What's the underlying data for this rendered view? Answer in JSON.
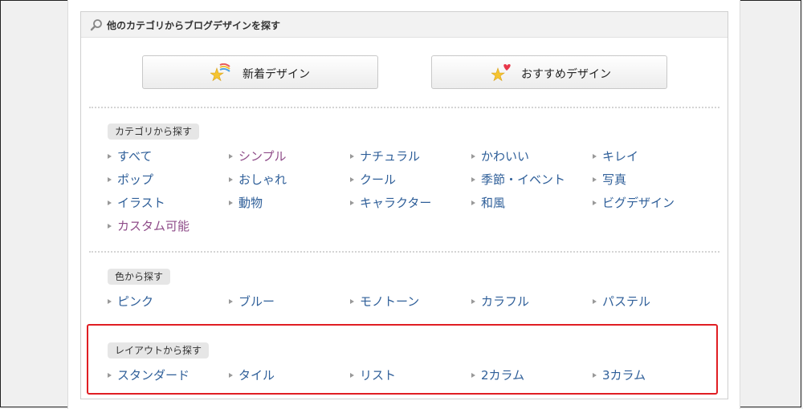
{
  "panel": {
    "title": "他のカテゴリからブログデザインを探す",
    "search_icon": "search-icon"
  },
  "buttons": [
    {
      "label": "新着デザイン",
      "icon": "star-rainbow-icon"
    },
    {
      "label": "おすすめデザイン",
      "icon": "star-heart-icon"
    }
  ],
  "sections": {
    "category": {
      "tag": "カテゴリから探す",
      "items": [
        {
          "label": "すべて"
        },
        {
          "label": "シンプル",
          "visited": true
        },
        {
          "label": "ナチュラル"
        },
        {
          "label": "かわいい"
        },
        {
          "label": "キレイ"
        },
        {
          "label": "ポップ"
        },
        {
          "label": "おしゃれ"
        },
        {
          "label": "クール"
        },
        {
          "label": "季節・イベント"
        },
        {
          "label": "写真"
        },
        {
          "label": "イラスト"
        },
        {
          "label": "動物"
        },
        {
          "label": "キャラクター"
        },
        {
          "label": "和風"
        },
        {
          "label": "ビグデザイン"
        },
        {
          "label": "カスタム可能",
          "visited": true
        }
      ]
    },
    "color": {
      "tag": "色から探す",
      "items": [
        {
          "label": "ピンク"
        },
        {
          "label": "ブルー"
        },
        {
          "label": "モノトーン"
        },
        {
          "label": "カラフル"
        },
        {
          "label": "パステル"
        }
      ]
    },
    "layout": {
      "tag": "レイアウトから探す",
      "items": [
        {
          "label": "スタンダード"
        },
        {
          "label": "タイル"
        },
        {
          "label": "リスト"
        },
        {
          "label": "2カラム"
        },
        {
          "label": "3カラム"
        }
      ]
    }
  },
  "colors": {
    "link": "#2f5f99",
    "visited_link": "#8e4b88",
    "highlight": "#e01e23"
  }
}
